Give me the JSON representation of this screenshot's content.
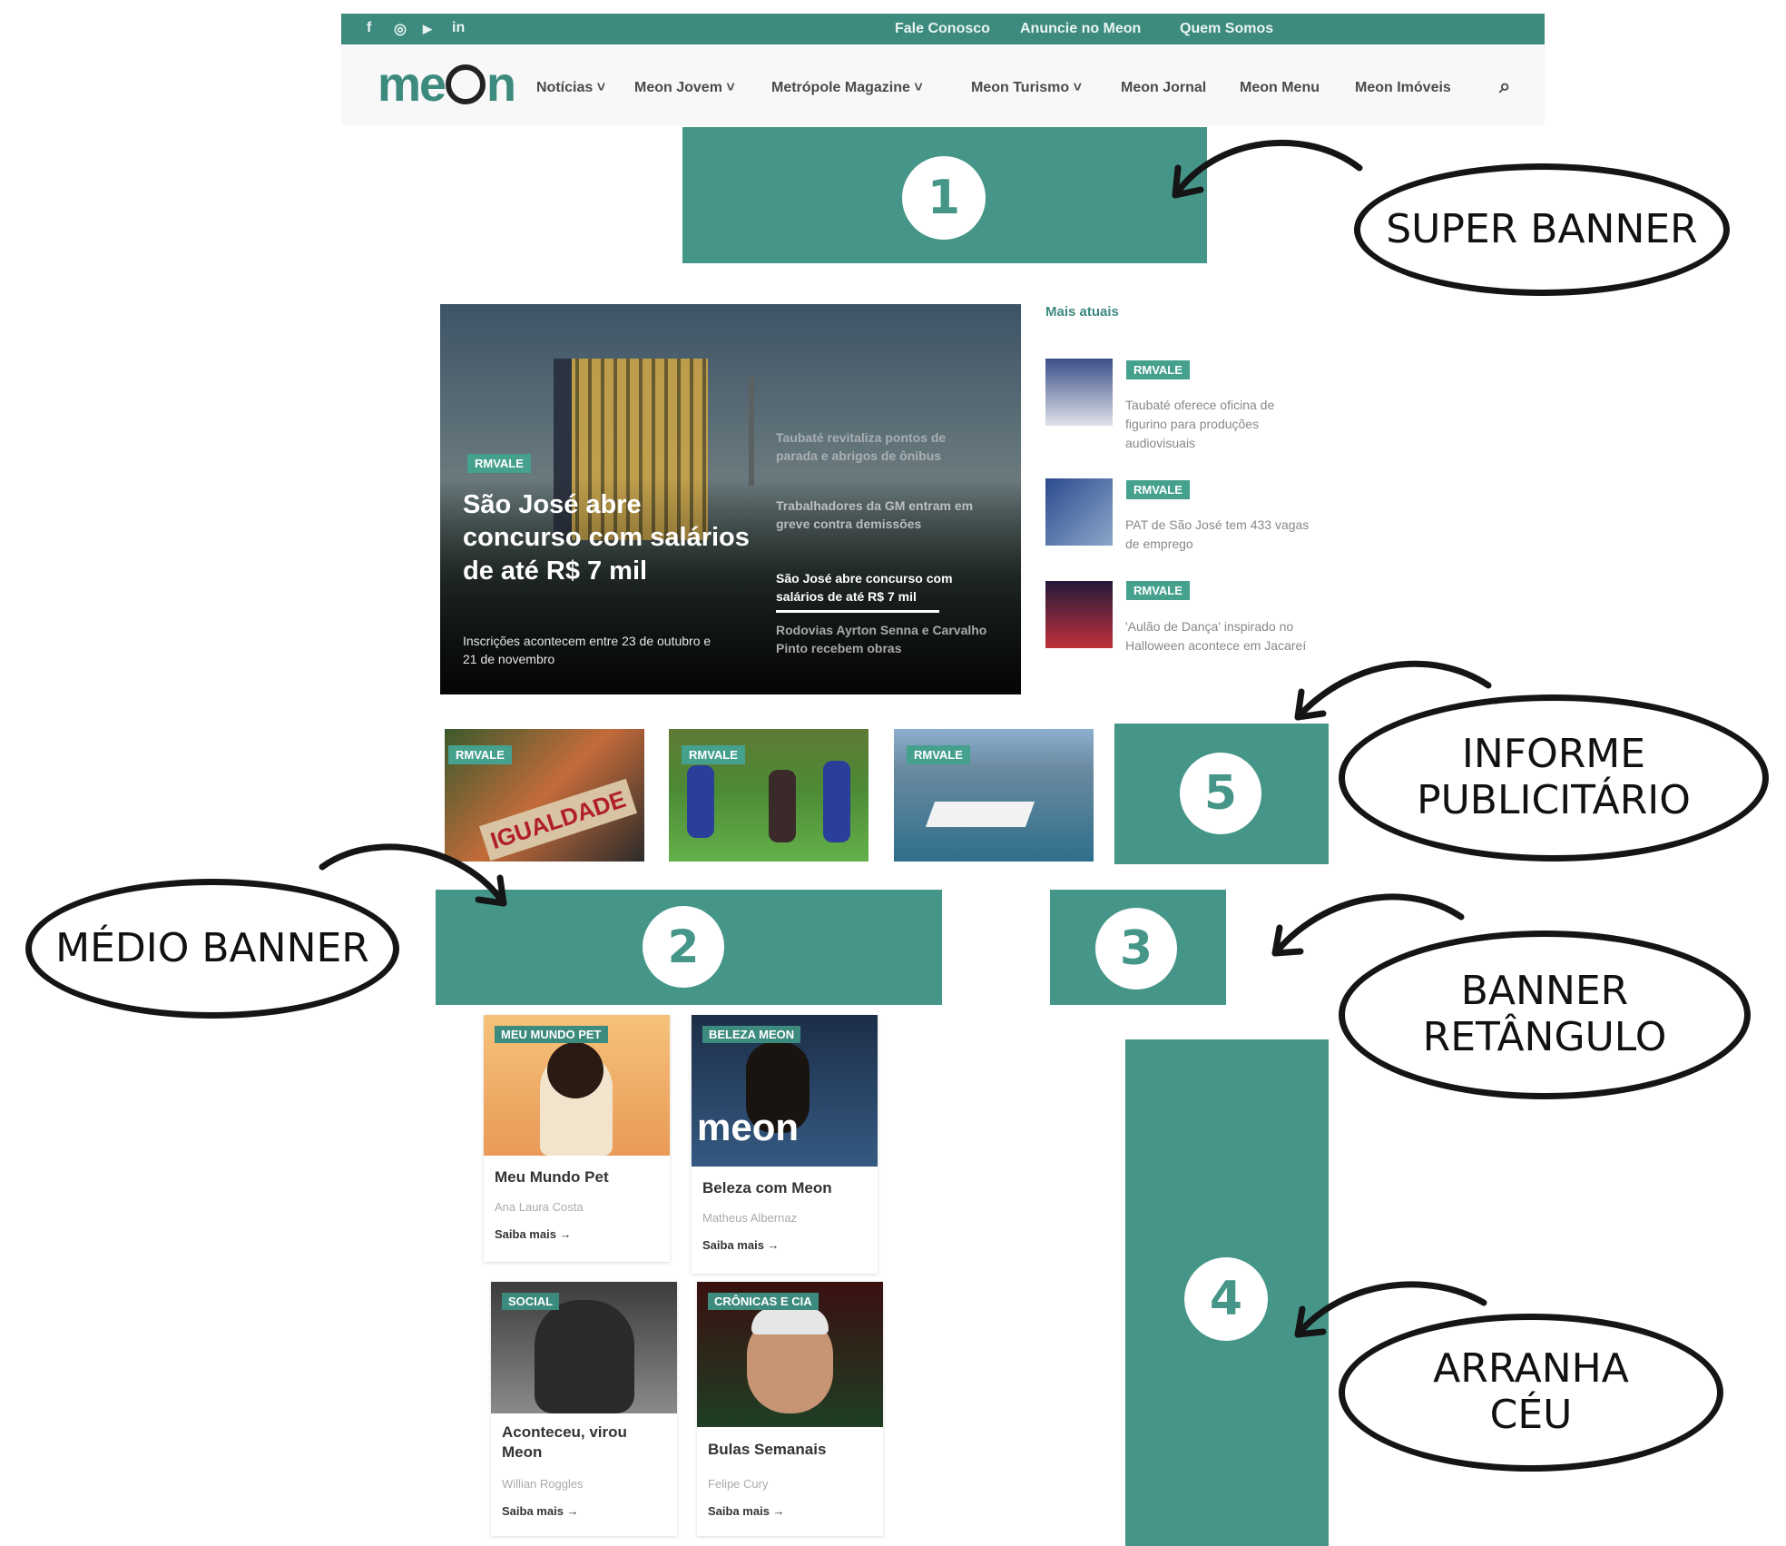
{
  "topbar": {
    "social_icons": [
      "facebook-icon",
      "instagram-icon",
      "youtube-icon",
      "linkedin-icon"
    ],
    "social_glyphs": [
      "f",
      "◎",
      "▶",
      "in"
    ],
    "links": [
      "Fale Conosco",
      "Anuncie no Meon",
      "Quem Somos"
    ]
  },
  "header": {
    "logo_pre": "me",
    "logo_post": "n",
    "nav": [
      "Notícias ˅",
      "Meon Jovem ˅",
      "Metrópole Magazine ˅",
      "Meon Turismo ˅",
      "Meon Jornal",
      "Meon Menu",
      "Meon Imóveis"
    ],
    "search_glyph": "⌕"
  },
  "ads": {
    "super_banner": "1",
    "medio_banner": "2",
    "banner_retangulo": "3",
    "arranha_ceu": "4",
    "informe_publicitario": "5"
  },
  "labels": {
    "super_banner": "SUPER BANNER",
    "informe": [
      "INFORME",
      "PUBLICITÁRIO"
    ],
    "medio_banner": "MÉDIO BANNER",
    "banner_retangulo": [
      "BANNER",
      "RETÂNGULO"
    ],
    "arranha_ceu": [
      "ARRANHA",
      "CÉU"
    ]
  },
  "hero": {
    "tag": "RMVALE",
    "headline": "São José abre concurso com salários de até R$ 7 mil",
    "subtitle": "Inscrições acontecem entre 23 de outubro e 21 de novembro",
    "list": [
      "Taubaté revitaliza pontos de parada e abrigos de ônibus",
      "Trabalhadores da GM entram em greve contra demissões",
      "São José abre concurso com salários de até R$ 7 mil",
      "Rodovias Ayrton Senna e Carvalho Pinto recebem obras"
    ]
  },
  "sidebar": {
    "title": "Mais atuais",
    "items": [
      {
        "tag": "RMVALE",
        "text": "Taubaté oferece oficina de figurino para produções audiovisuais"
      },
      {
        "tag": "RMVALE",
        "text": "PAT de São José tem 433 vagas de emprego"
      },
      {
        "tag": "RMVALE",
        "text": "'Aulão de Dança' inspirado no Halloween acontece em Jacareí"
      }
    ]
  },
  "thumbs": [
    {
      "tag": "RMVALE",
      "sign": "IGUALDADE"
    },
    {
      "tag": "RMVALE"
    },
    {
      "tag": "RMVALE"
    }
  ],
  "columns": [
    {
      "tag": "MEU MUNDO PET",
      "title": "Meu Mundo Pet",
      "author": "Ana Laura Costa",
      "more": "Saiba mais →"
    },
    {
      "tag": "BELEZA MEON",
      "title": "Beleza com Meon",
      "author": "Matheus Albernaz",
      "more": "Saiba mais →",
      "watermark": "meon"
    },
    {
      "tag": "SOCIAL",
      "title": "Aconteceu, virou Meon",
      "author": "Willian Roggles",
      "more": "Saiba mais →"
    },
    {
      "tag": "CRÔNICAS E CIA",
      "title": "Bulas Semanais",
      "author": "Felipe Cury",
      "more": "Saiba mais →"
    }
  ],
  "colors": {
    "brand": "#459688",
    "dark": "#151515"
  }
}
